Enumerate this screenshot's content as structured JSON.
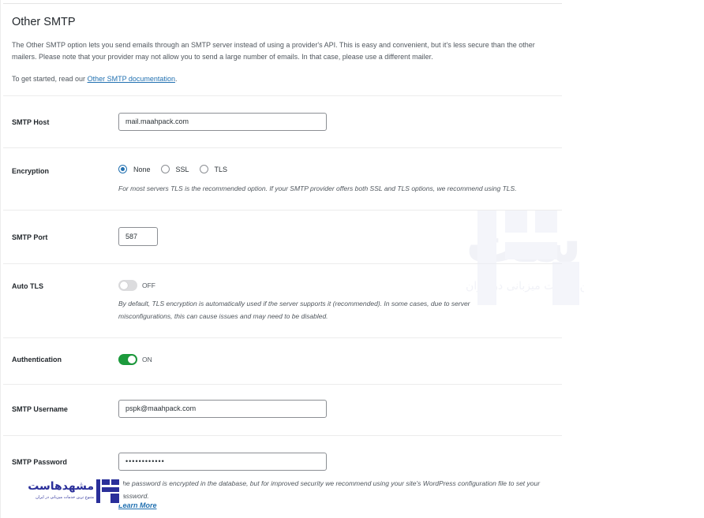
{
  "section": {
    "title": "Other SMTP",
    "description": "The Other SMTP option lets you send emails through an SMTP server instead of using a provider's API. This is easy and convenient, but it's less secure than the other mailers. Please note that your provider may not allow you to send a large number of emails. In that case, please use a different mailer.",
    "get_started_prefix": "To get started, read our ",
    "get_started_link": "Other SMTP documentation",
    "get_started_suffix": "."
  },
  "smtp_host": {
    "label": "SMTP Host",
    "value": "mail.maahpack.com"
  },
  "encryption": {
    "label": "Encryption",
    "options": [
      "None",
      "SSL",
      "TLS"
    ],
    "selected": "None",
    "help": "For most servers TLS is the recommended option. If your SMTP provider offers both SSL and TLS options, we recommend using TLS."
  },
  "smtp_port": {
    "label": "SMTP Port",
    "value": "587"
  },
  "auto_tls": {
    "label": "Auto TLS",
    "state": "OFF",
    "help": "By default, TLS encryption is automatically used if the server supports it (recommended). In some cases, due to server misconfigurations, this can cause issues and may need to be disabled."
  },
  "authentication": {
    "label": "Authentication",
    "state": "ON"
  },
  "smtp_username": {
    "label": "SMTP Username",
    "value": "pspk@maahpack.com"
  },
  "smtp_password": {
    "label": "SMTP Password",
    "value": "••••••••••••",
    "help": "The password is encrypted in the database, but for improved security we recommend using your site's WordPress configuration file to set your password.",
    "learn_more": "Learn More"
  },
  "watermark": {
    "main": "مشهدهاست",
    "sub": "متنوع ترین خدمات میزبانی در ایران"
  },
  "colors": {
    "accent": "#2271b1",
    "toggle_on": "#1c9a3c",
    "watermark": "#2a2f9a"
  }
}
